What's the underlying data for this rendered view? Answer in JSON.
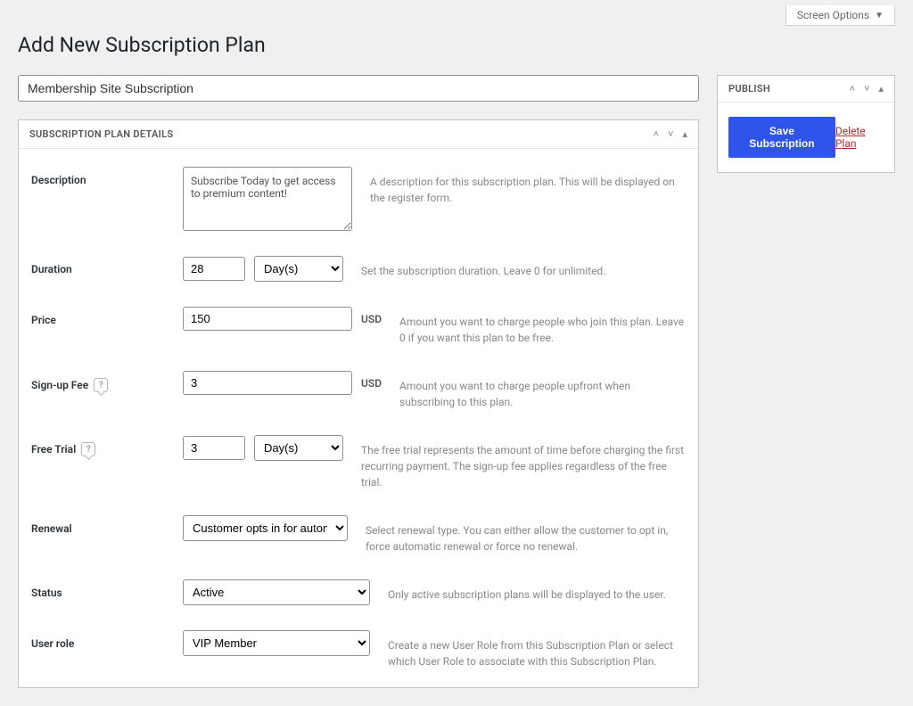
{
  "topbar": {
    "screen_options": "Screen Options"
  },
  "page": {
    "title": "Add New Subscription Plan",
    "post_title_value": "Membership Site Subscription"
  },
  "details_box": {
    "heading": "SUBSCRIPTION PLAN DETAILS"
  },
  "fields": {
    "description": {
      "label": "Description",
      "value": "Subscribe Today to get access to premium content!",
      "help": "A description for this subscription plan. This will be displayed on the register form."
    },
    "duration": {
      "label": "Duration",
      "value": "28",
      "unit": "Day(s)",
      "help": "Set the subscription duration. Leave 0 for unlimited."
    },
    "price": {
      "label": "Price",
      "value": "150",
      "currency": "USD",
      "help": "Amount you want to charge people who join this plan. Leave 0 if you want this plan to be free."
    },
    "signup_fee": {
      "label": "Sign-up Fee",
      "value": "3",
      "currency": "USD",
      "help": "Amount you want to charge people upfront when subscribing to this plan."
    },
    "free_trial": {
      "label": "Free Trial",
      "value": "3",
      "unit": "Day(s)",
      "help": "The free trial represents the amount of time before charging the first recurring payment. The sign-up fee applies regardless of the free trial."
    },
    "renewal": {
      "label": "Renewal",
      "value": "Customer opts in for automatic renewal",
      "help": "Select renewal type. You can either allow the customer to opt in, force automatic renewal or force no renewal."
    },
    "status": {
      "label": "Status",
      "value": "Active",
      "help": "Only active subscription plans will be displayed to the user."
    },
    "user_role": {
      "label": "User role",
      "value": "VIP Member",
      "help": "Create a new User Role from this Subscription Plan or select which User Role to associate with this Subscription Plan."
    }
  },
  "publish": {
    "heading": "PUBLISH",
    "save_label": "Save Subscription",
    "delete_label": "Delete Plan"
  }
}
